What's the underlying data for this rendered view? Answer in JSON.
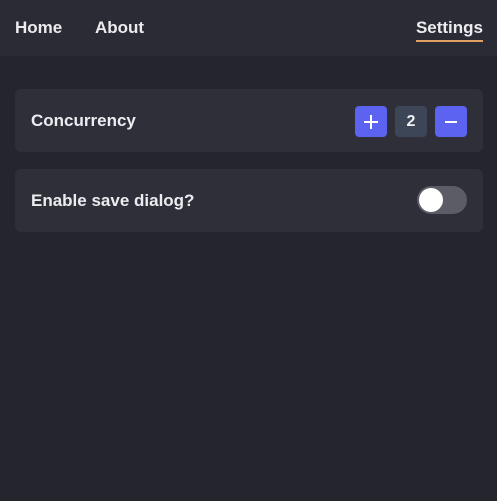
{
  "nav": {
    "items": [
      {
        "label": "Home"
      },
      {
        "label": "About"
      },
      {
        "label": "Settings"
      }
    ],
    "active": "Settings"
  },
  "settings": {
    "concurrency": {
      "label": "Concurrency",
      "value": "2",
      "increment_icon": "plus-icon",
      "decrement_icon": "minus-icon"
    },
    "save_dialog": {
      "label": "Enable save dialog?",
      "enabled": false
    }
  },
  "colors": {
    "background": "#25252e",
    "topbar": "#2b2b35",
    "card": "#2f2f3a",
    "accent_button": "#5b63f0",
    "value_box": "#3d4656",
    "active_underline": "#e0a263",
    "toggle_off": "#5c5c66"
  }
}
